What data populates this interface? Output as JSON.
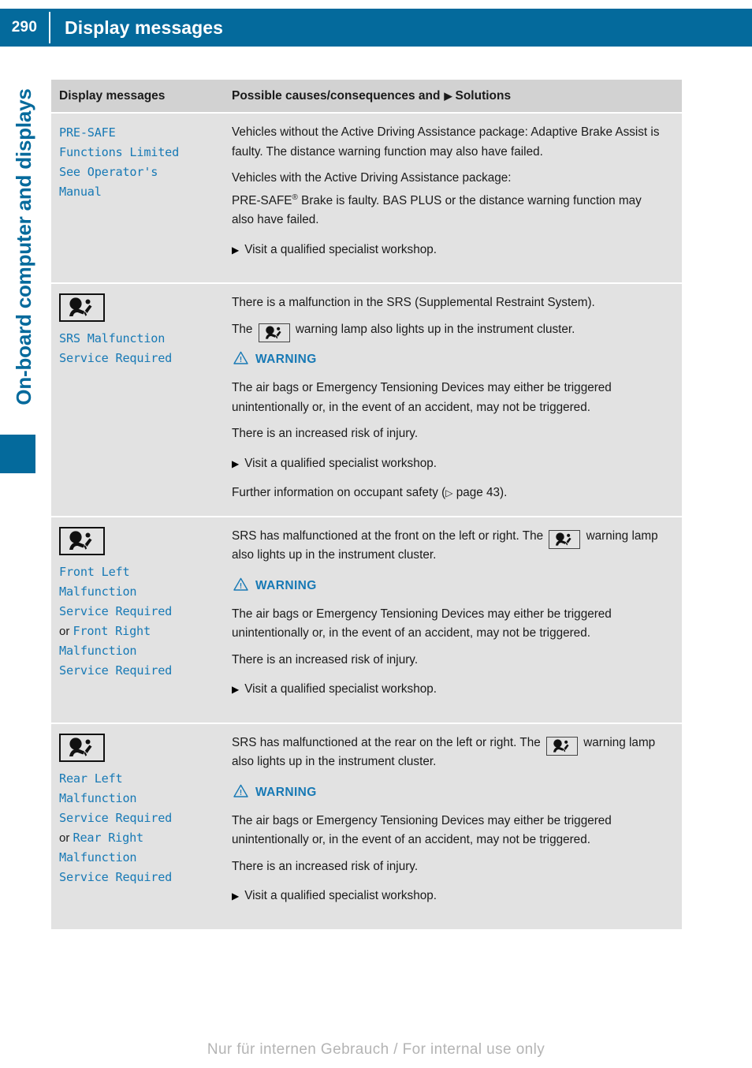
{
  "header": {
    "page_number": "290",
    "title": "Display messages"
  },
  "chapter": {
    "title": "On-board computer and displays"
  },
  "table": {
    "columns": [
      {
        "label": "Display messages"
      },
      {
        "label_before": "Possible causes/consequences and",
        "marker": "▶",
        "label_after": "Solutions"
      }
    ],
    "rows": [
      {
        "id": "pre-safe-functions-limited",
        "icon": null,
        "message_lines": [
          {
            "text": "PRE-SAFE",
            "style": "code"
          },
          {
            "text": "Functions Limited",
            "style": "code"
          },
          {
            "text": "See Operator's",
            "style": "code"
          },
          {
            "text": "Manual",
            "style": "code"
          }
        ],
        "paragraphs": [
          "Vehicles without the Active Driving Assistance package: Adaptive Brake Assist is faulty. The distance warning function may also have failed.",
          "Vehicles with the Active Driving Assistance package:"
        ],
        "paragraph_presafe": {
          "prefix": "PRE-SAFE",
          "superscript": "®",
          "suffix": " Brake is faulty. BAS PLUS or the distance warning function may also have failed."
        },
        "warning": null,
        "solution": "Visit a qualified specialist workshop.",
        "further_info": null
      },
      {
        "id": "srs-malfunction",
        "icon": "airbag-srs-icon",
        "message_lines": [
          {
            "text": "SRS Malfunction",
            "style": "code"
          },
          {
            "text": "Service Required",
            "style": "code"
          }
        ],
        "paragraphs": [
          "There is a malfunction in the SRS (Supplemental Restraint System)."
        ],
        "lamp_sentence": {
          "before": "The",
          "after": "warning lamp also lights up in the instrument cluster."
        },
        "warning": {
          "label": "WARNING",
          "paragraphs": [
            "The air bags or Emergency Tensioning Devices may either be triggered unintentionally or, in the event of an accident, may not be triggered.",
            "There is an increased risk of injury."
          ]
        },
        "solution": "Visit a qualified specialist workshop.",
        "further_info": {
          "before": "Further information on occupant safety (",
          "marker": "▷",
          "after": " page 43)."
        }
      },
      {
        "id": "front-left-right-malfunction",
        "icon": "airbag-srs-icon",
        "message_lines": [
          {
            "text": "Front Left",
            "style": "code"
          },
          {
            "text": "Malfunction",
            "style": "code"
          },
          {
            "text": "Service Required",
            "style": "code"
          },
          {
            "text": "or ",
            "style": "plain",
            "text2": "Front Right",
            "style2": "code"
          },
          {
            "text": "Malfunction",
            "style": "code"
          },
          {
            "text": "Service Required",
            "style": "code"
          }
        ],
        "lamp_sentence_lead": {
          "before": "SRS has malfunctioned at the front on the left or right. The",
          "after": "warning lamp also lights up in the instrument cluster."
        },
        "warning": {
          "label": "WARNING",
          "paragraphs": [
            "The air bags or Emergency Tensioning Devices may either be triggered unintentionally or, in the event of an accident, may not be triggered.",
            "There is an increased risk of injury."
          ]
        },
        "solution": "Visit a qualified specialist workshop.",
        "further_info": null
      },
      {
        "id": "rear-left-right-malfunction",
        "icon": "airbag-srs-icon",
        "message_lines": [
          {
            "text": "Rear Left",
            "style": "code"
          },
          {
            "text": "Malfunction",
            "style": "code"
          },
          {
            "text": "Service Required",
            "style": "code"
          },
          {
            "text": "or ",
            "style": "plain",
            "text2": "Rear Right",
            "style2": "code"
          },
          {
            "text": "Malfunction",
            "style": "code"
          },
          {
            "text": "Service Required",
            "style": "code"
          }
        ],
        "lamp_sentence_lead": {
          "before": "SRS has malfunctioned at the rear on the left or right. The",
          "after": "warning lamp also lights up in the instrument cluster."
        },
        "warning": {
          "label": "WARNING",
          "paragraphs": [
            "The air bags or Emergency Tensioning Devices may either be triggered unintentionally or, in the event of an accident, may not be triggered.",
            "There is an increased risk of injury."
          ]
        },
        "solution": "Visit a qualified specialist workshop.",
        "further_info": null
      }
    ]
  },
  "footer": {
    "note": "Nur für internen Gebrauch / For internal use only"
  },
  "colors": {
    "brand_blue": "#046a9c",
    "code_blue": "#1779b5",
    "header_cell_gray": "#d2d2d2",
    "body_cell_gray": "#e2e2e2",
    "footer_gray": "#b4b4b4"
  },
  "icons": {
    "airbag_srs": "airbag-srs-icon",
    "warning_triangle": "warning-triangle-icon",
    "solution_arrow": "▶",
    "page_ref_arrow": "▷"
  }
}
